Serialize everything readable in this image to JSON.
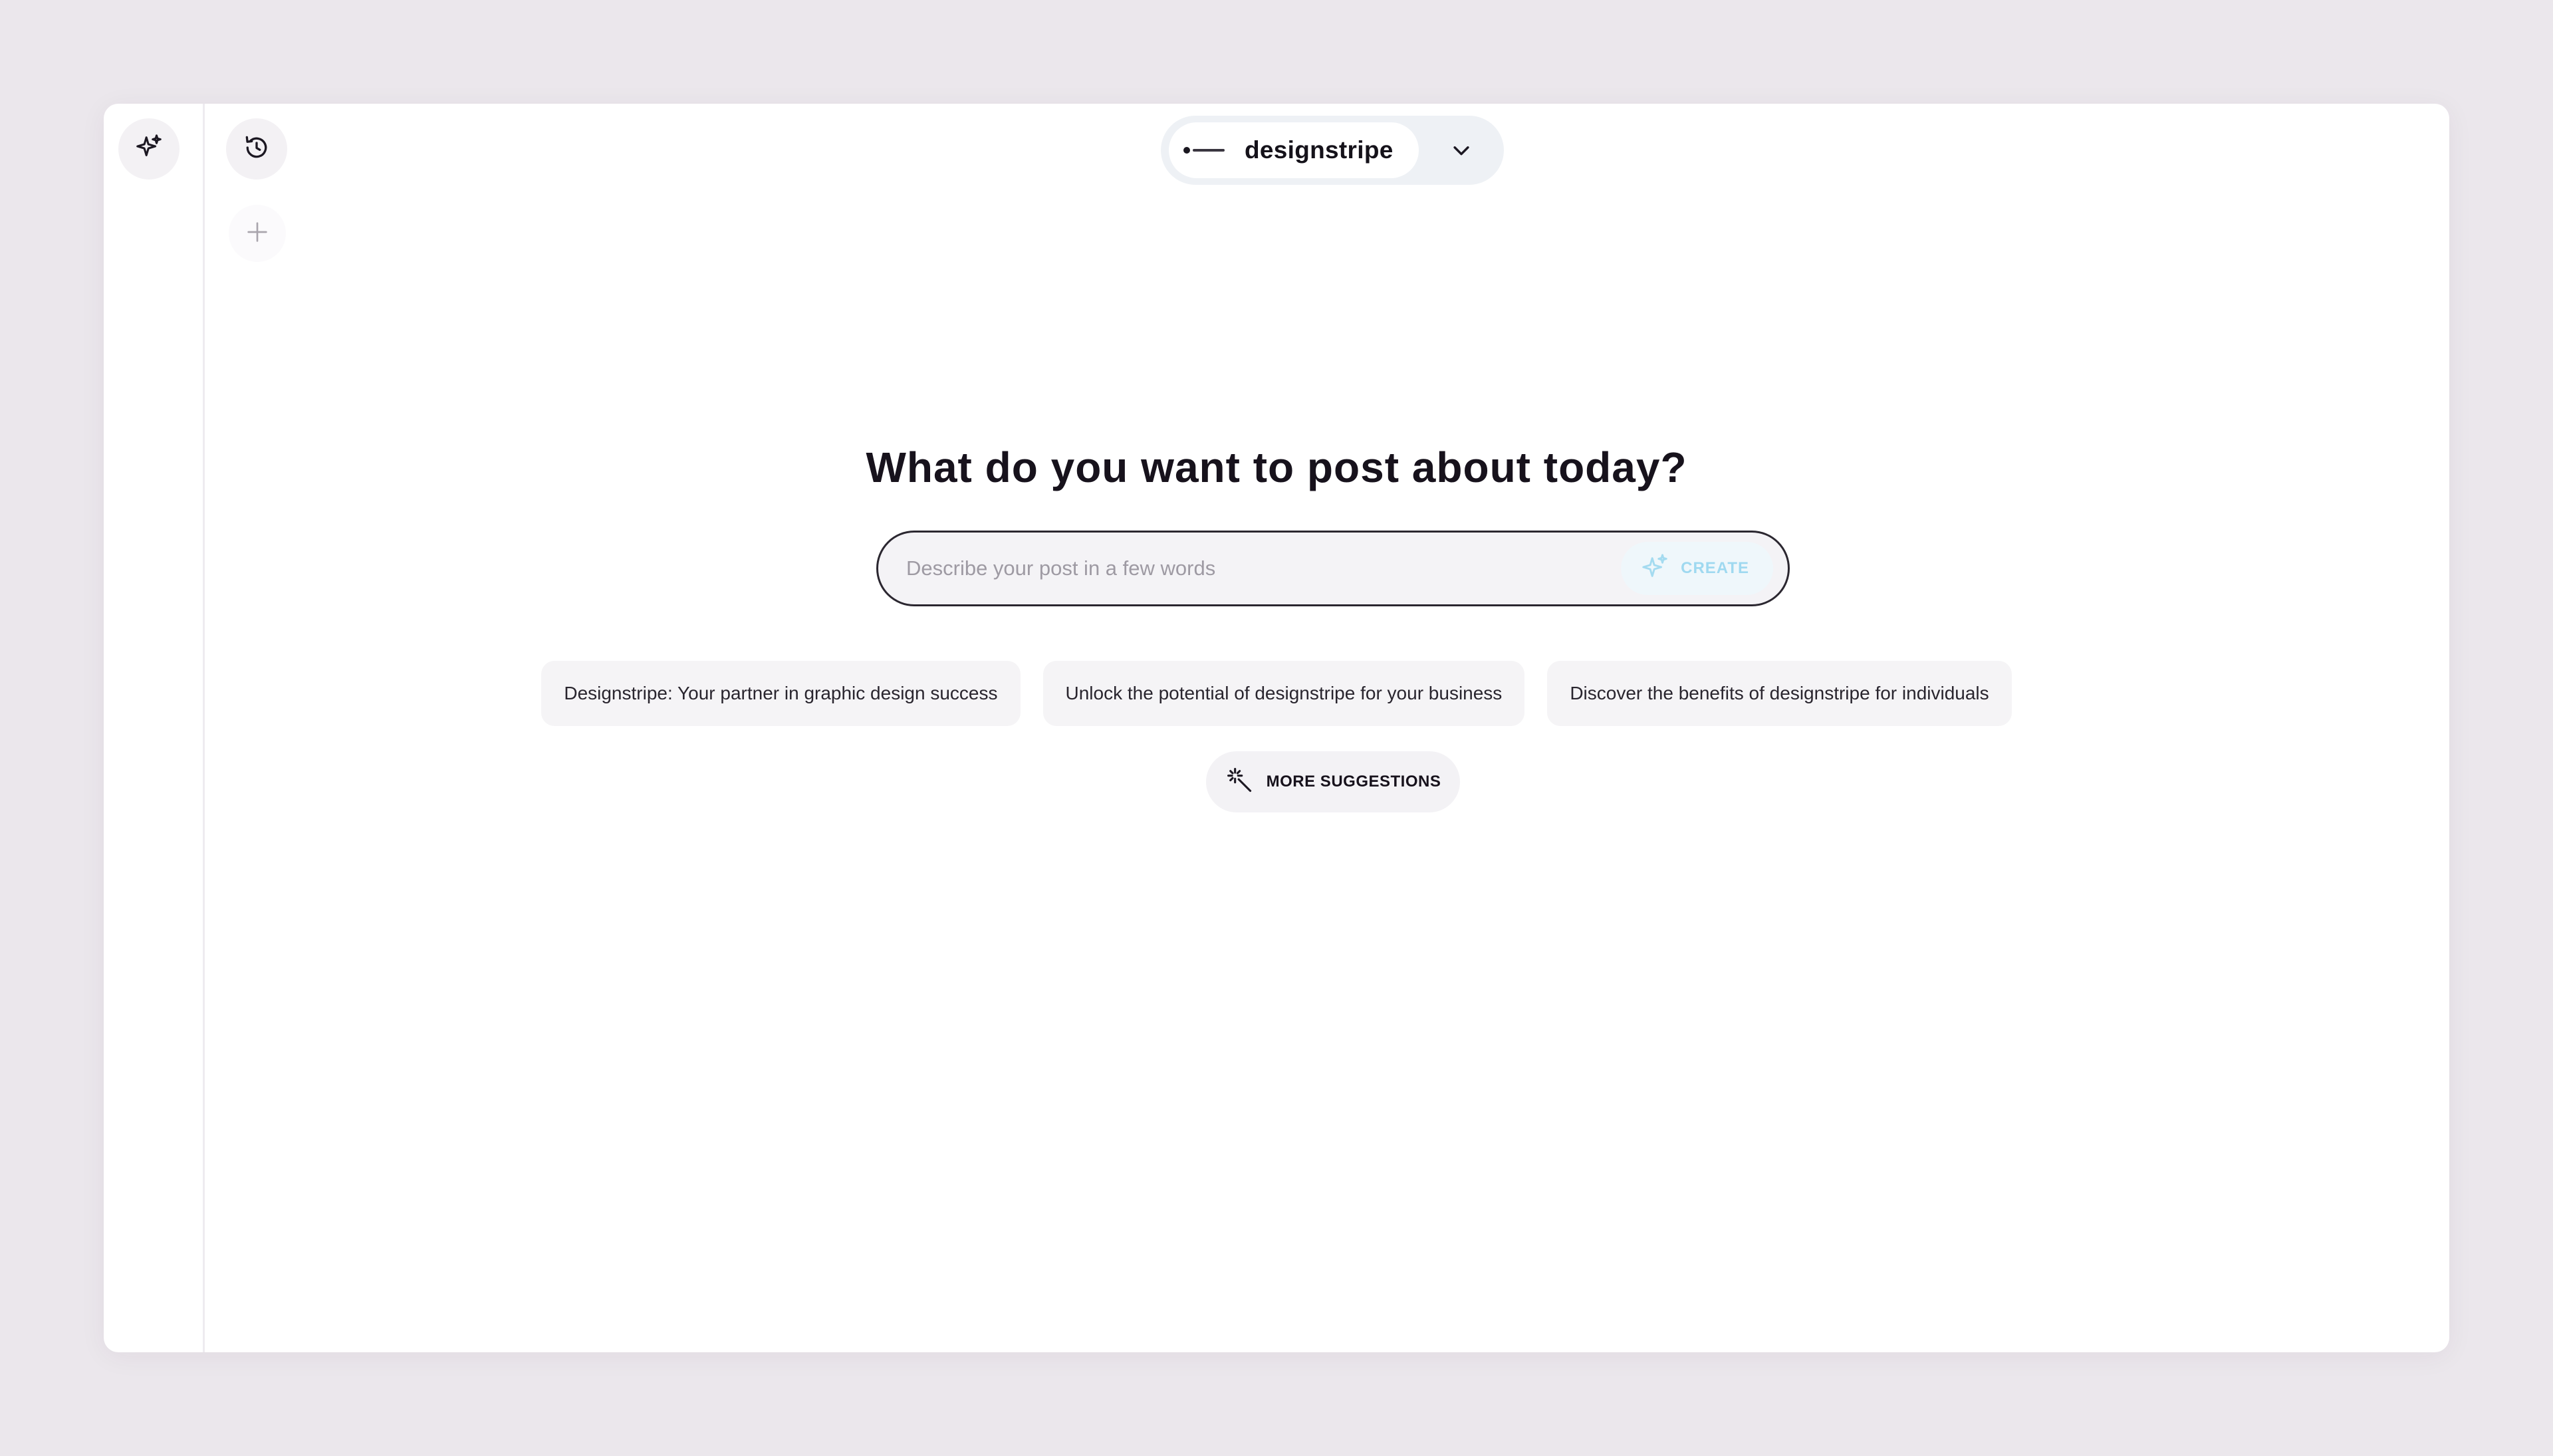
{
  "header": {
    "brand_name": "designstripe"
  },
  "main": {
    "headline": "What do you want to post about today?",
    "prompt": {
      "placeholder": "Describe your post in a few words",
      "value": "",
      "create_label": "CREATE"
    },
    "suggestions": [
      "Designstripe: Your partner in graphic design success",
      "Unlock the potential of designstripe for your business",
      "Discover the benefits of designstripe for individuals"
    ],
    "more_suggestions_label": "MORE SUGGESTIONS"
  },
  "icons": {
    "rail_top": "sparkles-icon",
    "history": "history-icon",
    "new": "plus-icon",
    "brand_dropdown": "chevron-down-icon",
    "create": "sparkles-icon",
    "more": "magic-wand-icon"
  },
  "colors": {
    "page_background": "#ebe7ec",
    "window_background": "#ffffff",
    "accent_light_blue": "#9fd9f0",
    "text_dark": "#15121a"
  }
}
